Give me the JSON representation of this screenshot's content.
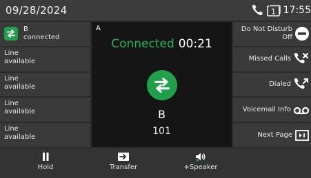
{
  "status_bar": {
    "date": "09/28/2024",
    "time": "17:55",
    "icons": [
      "phone-icon",
      "voicemail-count-icon"
    ]
  },
  "line_keys": [
    {
      "name": "B",
      "status": "connected",
      "icon": "transfer-arrows-icon",
      "active": true
    },
    {
      "name": "Line",
      "status": "available"
    },
    {
      "name": "Line",
      "status": "available"
    },
    {
      "name": "Line",
      "status": "available"
    },
    {
      "name": "Line",
      "status": "available"
    }
  ],
  "call": {
    "pane_label": "A",
    "state": "Connected",
    "timer": "00:21",
    "contact_name": "B",
    "contact_number": "101",
    "avatar_icon": "transfer-arrows-icon"
  },
  "feature_keys": [
    {
      "label": "Do Not Disturb",
      "sublabel": "Off",
      "icon": "do-not-disturb-icon"
    },
    {
      "label": "Missed Calls",
      "icon": "missed-call-icon"
    },
    {
      "label": "Dialed",
      "icon": "dialed-call-icon"
    },
    {
      "label": "Voicemail Info",
      "icon": "voicemail-icon"
    },
    {
      "label": "Next Page",
      "icon": "next-page-icon"
    }
  ],
  "softkeys": [
    {
      "label": "Hold",
      "icon": "pause-icon"
    },
    {
      "label": "Transfer",
      "icon": "transfer-icon"
    },
    {
      "label": "+Speaker",
      "icon": "speaker-icon"
    }
  ],
  "colors": {
    "accent_green": "#21a04b",
    "connected_text": "#22b356",
    "panel_dark": "#151515",
    "key_bg": "#3a3a3a",
    "background": "#2a2a2a"
  }
}
